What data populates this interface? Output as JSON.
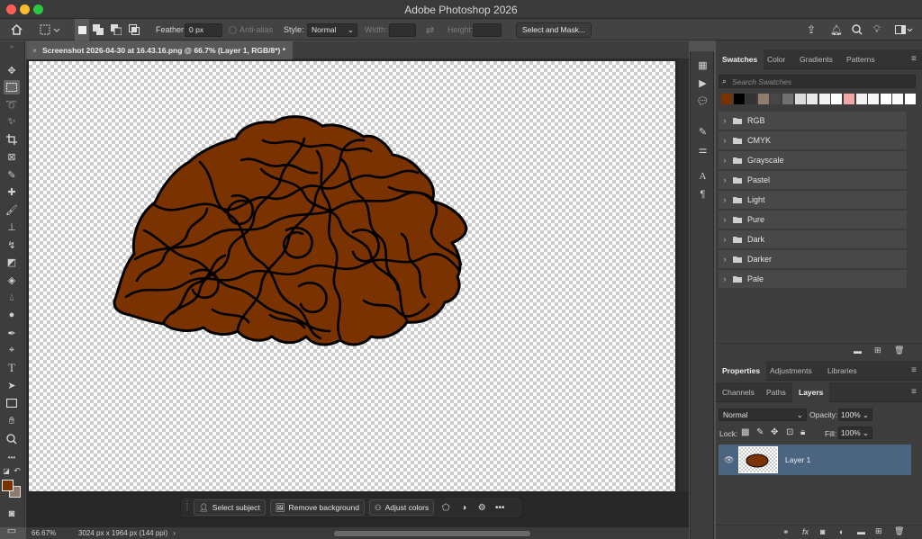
{
  "window": {
    "title": "Adobe Photoshop 2026"
  },
  "options": {
    "feather_label": "Feather:",
    "feather_value": "0 px",
    "antialias_label": "Anti-alias",
    "style_label": "Style:",
    "style_value": "Normal",
    "width_label": "Width:",
    "height_label": "Height:",
    "select_mask": "Select and Mask..."
  },
  "document": {
    "tab_title": "Screenshot 2026-04-30 at 16.43.16.png @ 66.7% (Layer 1, RGB/8*) *"
  },
  "context_bar": {
    "select_subject": "Select subject",
    "remove_background": "Remove background",
    "adjust_colors": "Adjust colors",
    "more": "•••"
  },
  "status": {
    "zoom": "66.67%",
    "info": "3024 px x 1964 px (144 ppi)"
  },
  "swatches": {
    "tabs": [
      "Swatches",
      "Color",
      "Gradients",
      "Patterns"
    ],
    "search_placeholder": "Search Swatches",
    "colors": [
      "#7a3200",
      "#000000",
      "#333333",
      "#8c7f72",
      "#474747",
      "#707070",
      "#dcdcdc",
      "#e8eaea",
      "#f3f3f3",
      "#ffffff",
      "#f3a8a8",
      "#f2f2f2",
      "#f7f7f7",
      "#ffffff",
      "#fafafa",
      "#ffffff"
    ],
    "folders": [
      "RGB",
      "CMYK",
      "Grayscale",
      "Pastel",
      "Light",
      "Pure",
      "Dark",
      "Darker",
      "Pale"
    ]
  },
  "properties_tabs": [
    "Properties",
    "Adjustments",
    "Libraries"
  ],
  "layers": {
    "tabs": [
      "Channels",
      "Paths",
      "Layers"
    ],
    "blend": "Normal",
    "opacity_label": "Opacity:",
    "opacity": "100%",
    "lock_label": "Lock:",
    "fill_label": "Fill:",
    "fill": "100%",
    "items": [
      {
        "name": "Layer 1"
      }
    ]
  },
  "colors": {
    "foreground": "#7a3300",
    "background": "#8a7c70",
    "fill": "#7a3300",
    "layer_selected": "#4b6580"
  }
}
